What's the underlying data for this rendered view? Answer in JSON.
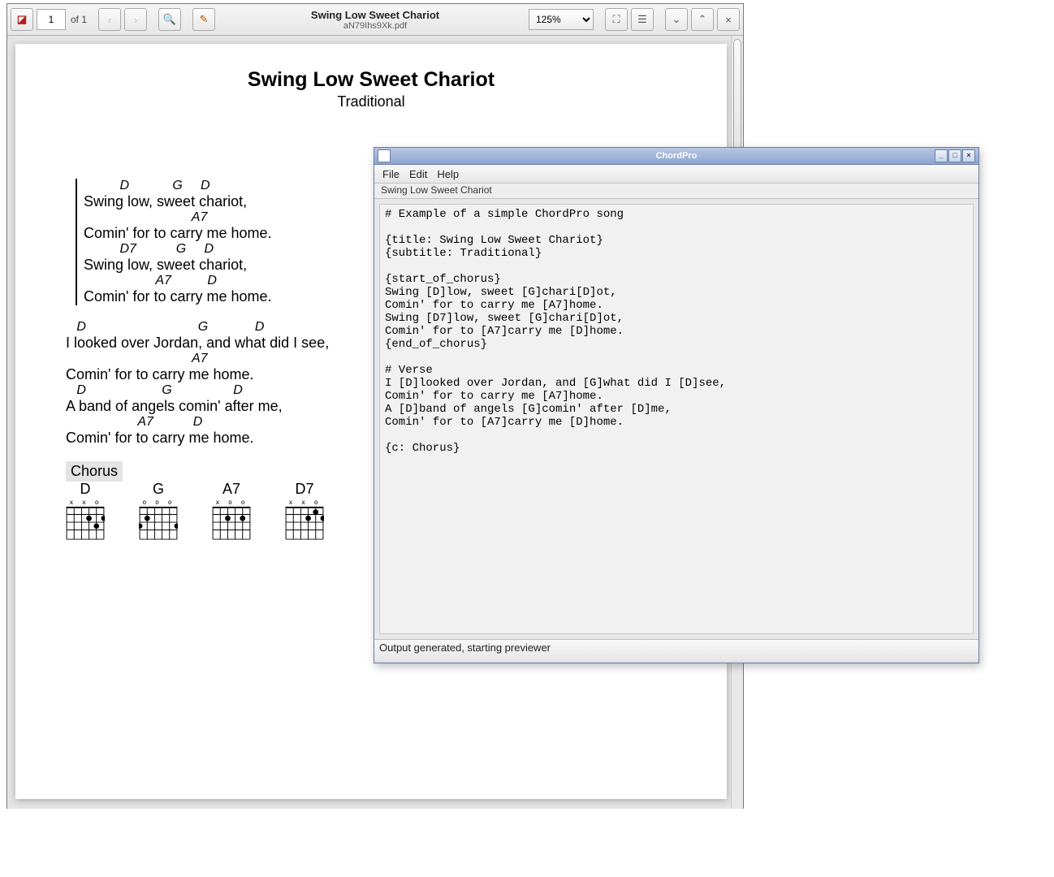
{
  "pdf": {
    "title": "Swing Low Sweet Chariot",
    "filename": "aN79Ihs9Xk.pdf",
    "page_current": "1",
    "page_of": "of 1",
    "zoom": "125%",
    "song_title": "Swing Low Sweet Chariot",
    "song_subtitle": "Traditional",
    "chorus": {
      "l1c": "          D            G     D",
      "l1": "Swing low, sweet chariot,",
      "l2c": "                              A7",
      "l2": "Comin' for to carry me home.",
      "l3c": "          D7           G     D",
      "l3": "Swing low, sweet chariot,",
      "l4c": "                    A7          D",
      "l4": "Comin' for to carry me home."
    },
    "verse": {
      "l1c": "   D                               G             D",
      "l1": "I looked over Jordan, and what did I see,",
      "l2c": "                                   A7",
      "l2": "Comin' for to carry me home.",
      "l3c": "   D                     G                 D",
      "l3": "A band of angels comin' after me,",
      "l4c": "                    A7           D",
      "l4": "Comin' for to carry me home."
    },
    "chorus_label": "Chorus",
    "chords": [
      "D",
      "G",
      "A7",
      "D7"
    ],
    "chord_marks": [
      "x x o",
      "  o o o",
      "x o   o",
      "x x o"
    ]
  },
  "chordpro": {
    "app_title": "ChordPro",
    "menu": {
      "file": "File",
      "edit": "Edit",
      "help": "Help"
    },
    "tab_label": "Swing Low Sweet Chariot",
    "text": "# Example of a simple ChordPro song\n\n{title: Swing Low Sweet Chariot}\n{subtitle: Traditional}\n\n{start_of_chorus}\nSwing [D]low, sweet [G]chari[D]ot,\nComin' for to carry me [A7]home.\nSwing [D7]low, sweet [G]chari[D]ot,\nComin' for to [A7]carry me [D]home.\n{end_of_chorus}\n\n# Verse\nI [D]looked over Jordan, and [G]what did I [D]see,\nComin' for to carry me [A7]home.\nA [D]band of angels [G]comin' after [D]me,\nComin' for to [A7]carry me [D]home.\n\n{c: Chorus}",
    "status": "Output generated, starting previewer"
  }
}
